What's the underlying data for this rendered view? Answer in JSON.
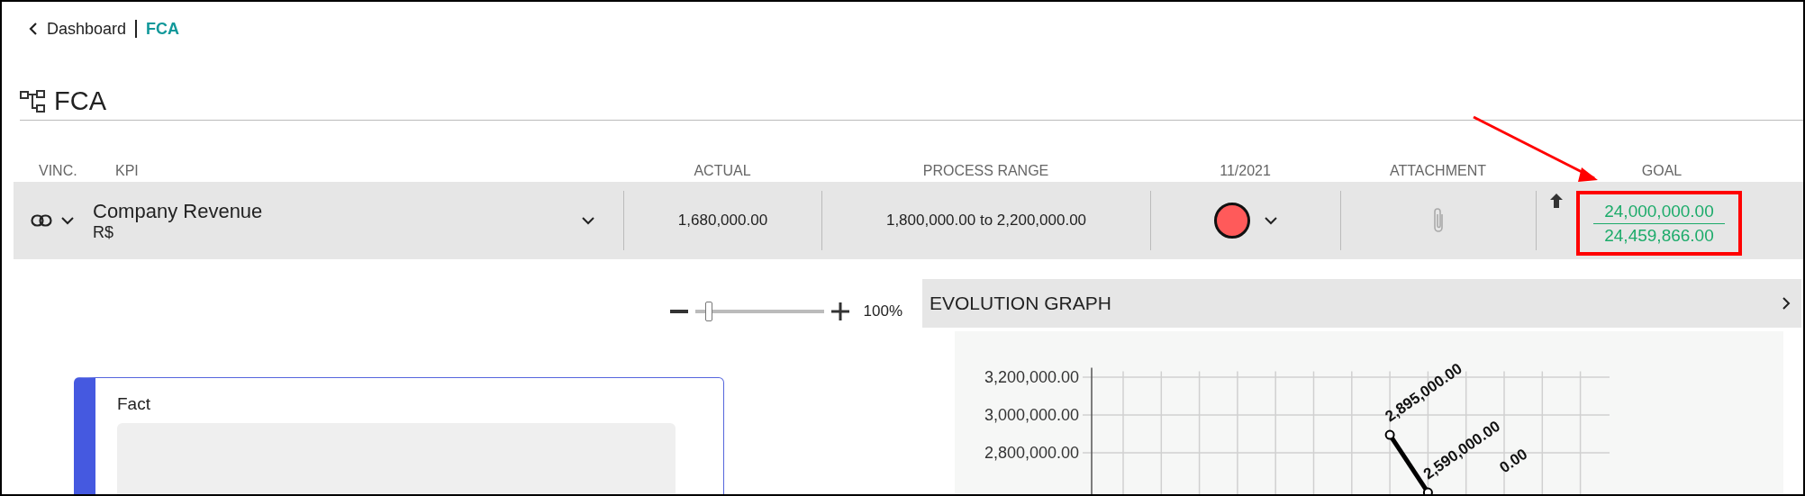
{
  "breadcrumb": {
    "back": "Dashboard",
    "current": "FCA"
  },
  "page_title": "FCA",
  "table": {
    "columns": [
      "VINC.",
      "KPI",
      "ACTUAL",
      "PROCESS RANGE",
      "11/2021",
      "ATTACHMENT",
      "GOAL"
    ],
    "rows": [
      {
        "kpi": "Company Revenue",
        "unit": "R$",
        "actual": "1,680,000.00",
        "process_range": "1,800,000.00 to 2,200,000.00",
        "color": "#ff5a5a",
        "goal": "24,000,000.00",
        "goal_actual": "24,459,866.00"
      }
    ]
  },
  "zoom": {
    "level": 0.11,
    "reading": "100%"
  },
  "fact_card": {
    "title": "Fact"
  },
  "evolution_graph": {
    "title": "EVOLUTION GRAPH",
    "chart_data": {
      "type": "line",
      "grid": true,
      "ylim": [
        2400000,
        3250000
      ],
      "yticks": [
        {
          "value": 2800000,
          "label": "2,800,000.00"
        },
        {
          "value": 3000000,
          "label": "3,000,000.00"
        },
        {
          "value": 3200000,
          "label": "3,200,000.00"
        }
      ],
      "series": [
        {
          "color": "#000000",
          "marker": "circle",
          "values": [
            null,
            null,
            null,
            null,
            null,
            null,
            null,
            2895000,
            2590000,
            null,
            null,
            null,
            null
          ]
        }
      ],
      "value_labels": [
        null,
        null,
        null,
        null,
        null,
        null,
        null,
        "2,895,000.00",
        "2,590,000.00",
        null,
        "0.00",
        null,
        null
      ]
    }
  }
}
